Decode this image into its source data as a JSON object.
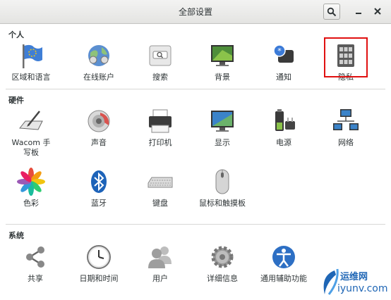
{
  "window": {
    "title": "全部设置"
  },
  "sections": [
    {
      "title": "个人",
      "items": [
        {
          "label": "区域和语言",
          "icon": "flag-icon"
        },
        {
          "label": "在线账户",
          "icon": "online-accounts-icon"
        },
        {
          "label": "搜索",
          "icon": "search-panel-icon"
        },
        {
          "label": "背景",
          "icon": "background-icon"
        },
        {
          "label": "通知",
          "icon": "notification-icon"
        },
        {
          "label": "隐私",
          "icon": "privacy-lock-icon"
        }
      ]
    },
    {
      "title": "硬件",
      "items": [
        {
          "label": "Wacom 手写板",
          "icon": "wacom-tablet-icon"
        },
        {
          "label": "声音",
          "icon": "sound-icon"
        },
        {
          "label": "打印机",
          "icon": "printer-icon"
        },
        {
          "label": "显示",
          "icon": "display-icon"
        },
        {
          "label": "电源",
          "icon": "power-icon"
        },
        {
          "label": "网络",
          "icon": "network-icon"
        },
        {
          "label": "色彩",
          "icon": "color-icon"
        },
        {
          "label": "蓝牙",
          "icon": "bluetooth-icon"
        },
        {
          "label": "键盘",
          "icon": "keyboard-icon"
        },
        {
          "label": "鼠标和触摸板",
          "icon": "mouse-icon"
        }
      ]
    },
    {
      "title": "系统",
      "items": [
        {
          "label": "共享",
          "icon": "share-icon"
        },
        {
          "label": "日期和时间",
          "icon": "clock-icon"
        },
        {
          "label": "用户",
          "icon": "users-icon"
        },
        {
          "label": "详细信息",
          "icon": "gear-icon"
        },
        {
          "label": "通用辅助功能",
          "icon": "accessibility-icon"
        }
      ]
    }
  ],
  "watermark": {
    "line1": "运维网",
    "line2": "iyunv.com"
  },
  "colors": {
    "highlight": "#e01010",
    "accent": "#1f66b5"
  }
}
